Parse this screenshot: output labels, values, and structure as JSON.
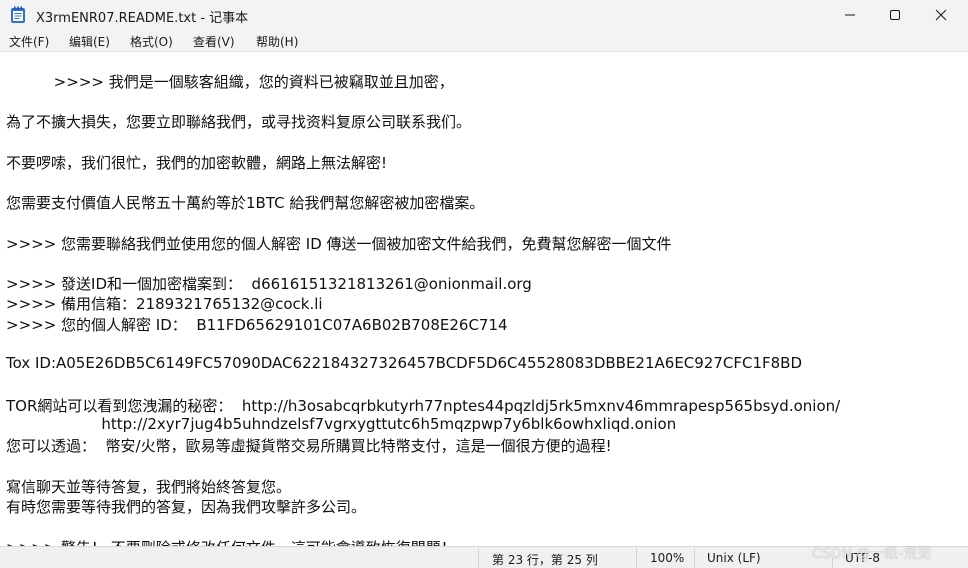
{
  "window": {
    "title": "X3rmENR07.README.txt - 记事本",
    "app_icon": "notepad-icon",
    "controls": {
      "minimize_icon": "minimize-icon",
      "maximize_icon": "maximize-icon",
      "close_icon": "close-icon"
    }
  },
  "menu": {
    "items": [
      {
        "label": "文件(F)"
      },
      {
        "label": "编辑(E)"
      },
      {
        "label": "格式(O)"
      },
      {
        "label": "查看(V)"
      },
      {
        "label": "帮助(H)"
      }
    ]
  },
  "document": {
    "lines": [
      "          >>>> 我們是一個駭客組織，您的資料已被竊取並且加密，",
      "為了不擴大損失，您要立即聯絡我們，或寻找资料复原公司联系我们。",
      "不要啰嗦，我们很忙，我們的加密軟體，網路上無法解密!",
      "您需要支付價值人民幣五十萬約等於1BTC 給我們幫您解密被加密檔案。",
      ">>>> 您需要聯絡我們並使用您的個人解密 ID 傳送一個被加密文件給我們，免費幫您解密一個文件",
      ">>>> 發送ID和一個加密檔案到：  d6616151321813261@onionmail.org",
      ">>>> 備用信箱：2189321765132@cock.li",
      ">>>> 您的個人解密 ID：  B11FD65629101C07A6B02B708E26C714",
      "Tox ID:A05E26DB5C6149FC57090DAC622184327326457BCDF5D6C45528083DBBE21A6EC927CFC1F8BD",
      "TOR網站可以看到您洩漏的秘密：  http://h3osabcqrbkutyrh77nptes44pqzldj5rk5mxnv46mmrapesp565bsyd.onion/",
      "                    http://2xyr7jug4b5uhndzelsf7vgrxygttutc6h5mqzpwp7y6blk6owhxliqd.onion",
      "您可以透過：  幣安/火幣，歐易等虛擬貨幣交易所購買比特幣支付，這是一個很方便的過程!",
      "寫信聊天並等待答复，我們將始終答复您。",
      "有時您需要等待我們的答复，因為我們攻擊許多公司。",
      ">>>> 警告！ 不要刪除或修改任何文件，這可能會導致恢復問題！"
    ]
  },
  "status": {
    "position": "第 23 行，第 25 列",
    "zoom": "100%",
    "line_ending": "Unix (LF)",
    "encoding": "UTF-8"
  },
  "watermark": "CSDN @一纸-荒芜",
  "colors": {
    "titlebar_bg": "#f3f3f3",
    "editor_bg": "#ffffff",
    "text": "#111111",
    "statusbar_bg": "#f0f0f0"
  }
}
